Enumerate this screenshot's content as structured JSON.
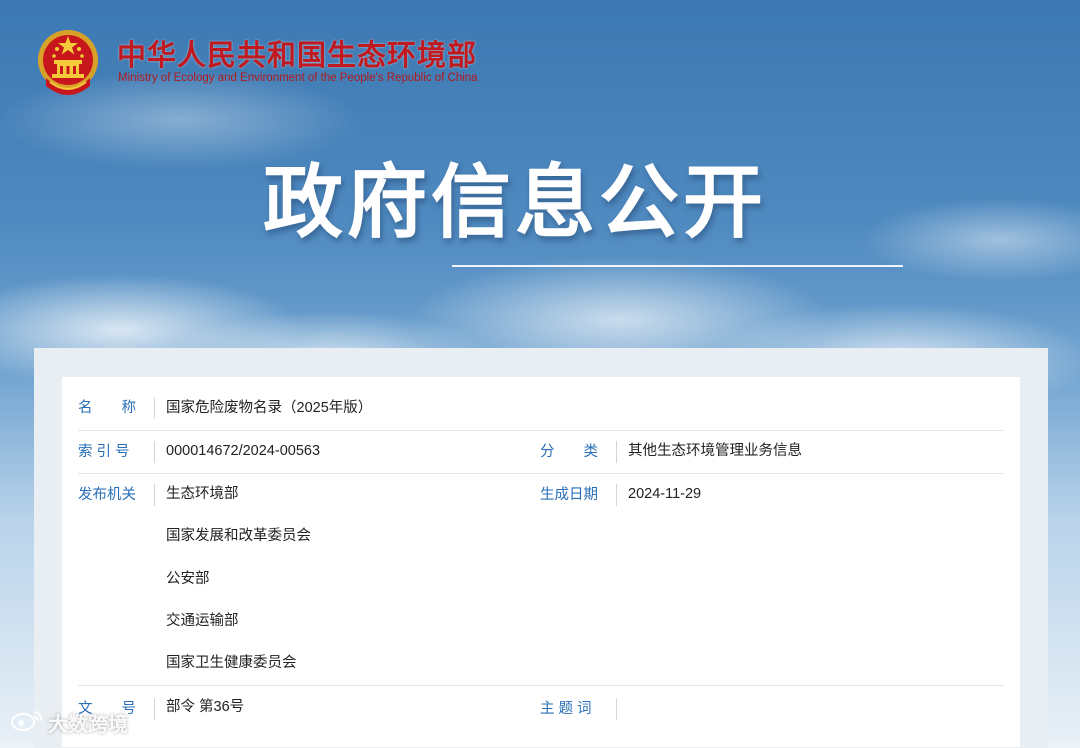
{
  "header": {
    "ministry_cn": "中华人民共和国生态环境部",
    "ministry_en": "Ministry of Ecology and Environment of the People's Republic of China",
    "emblem_icon": "national-emblem-icon",
    "hero_title": "政府信息公开"
  },
  "info": {
    "name_label": "名　　称",
    "name_value": "国家危险废物名录（2025年版）",
    "index_label": "索 引 号",
    "index_value": "000014672/2024-00563",
    "category_label": "分　　类",
    "category_value": "其他生态环境管理业务信息",
    "issuer_label": "发布机关",
    "issuers": [
      "生态环境部",
      "国家发展和改革委员会",
      "公安部",
      "交通运输部",
      "国家卫生健康委员会"
    ],
    "date_label": "生成日期",
    "date_value": "2024-11-29",
    "docno_label": "文　　号",
    "docno_value": "部令 第36号",
    "keywords_label": "主 题 词",
    "keywords_value": ""
  },
  "watermark": {
    "text": "大数跨境",
    "icon": "weibo-icon"
  },
  "colors": {
    "brand_red": "#c0191f",
    "label_blue": "#2a6fb8",
    "sky_blue": "#3c78b2"
  }
}
